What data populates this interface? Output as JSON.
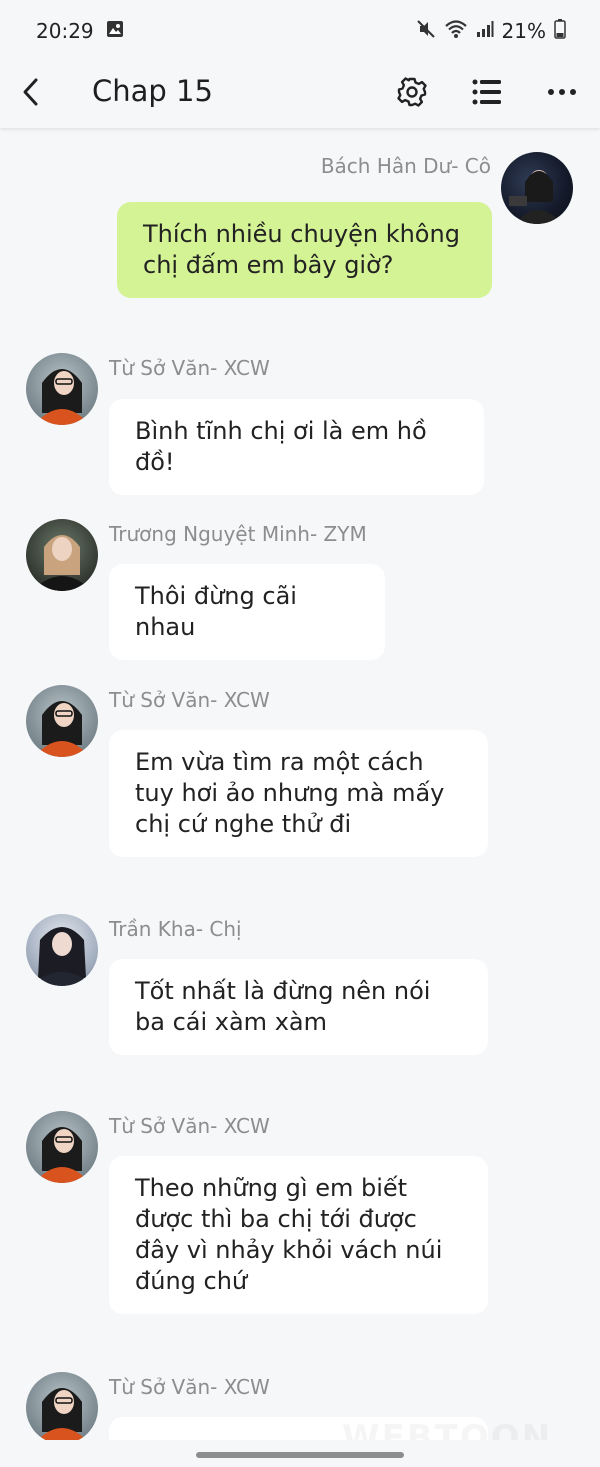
{
  "status": {
    "time": "20:29",
    "battery": "21%"
  },
  "header": {
    "title": "Chap 15"
  },
  "messages": [
    {
      "sender": "Bách Hân Dư- Cô",
      "text": "Thích nhiều chuyện không chị đấm em bây giờ?",
      "mine": true
    },
    {
      "sender": "Từ Sở Văn- XCW",
      "text": "Bình tĩnh chị ơi là em hồ đồ!"
    },
    {
      "sender": "Trương Nguyệt Minh- ZYM",
      "text": "Thôi đừng cãi nhau"
    },
    {
      "sender": "Từ Sở Văn- XCW",
      "text": "Em vừa tìm ra một cách tuy hơi ảo nhưng mà mấy chị cứ nghe thử đi"
    },
    {
      "sender": "Trần Kha- Chị",
      "text": "Tốt nhất là đừng nên nói ba cái xàm xàm"
    },
    {
      "sender": "Từ Sở Văn- XCW",
      "text": "Theo những gì em biết được thì ba chị tới được đây vì nhảy khỏi vách núi đúng chứ"
    },
    {
      "sender": "Từ Sở Văn- XCW",
      "text": ""
    }
  ],
  "watermark": "WEBTOON",
  "colors": {
    "mine_bubble": "#d4f394",
    "other_bubble": "#ffffff",
    "background": "#f6f7f9"
  }
}
